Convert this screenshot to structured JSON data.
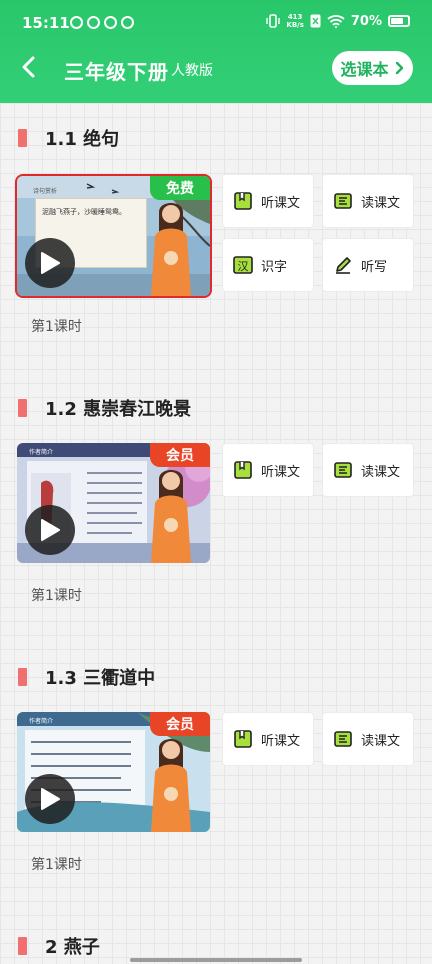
{
  "status_bar": {
    "time": "15:11",
    "net_speed": "413\nKB/s",
    "battery": "70%"
  },
  "header": {
    "title": "三年级下册",
    "edition": "人教版",
    "choose_label": "选课本"
  },
  "lessons": [
    {
      "title": "1.1 绝句",
      "badge": "免费",
      "period": "第1课时",
      "board_tag": "诗句赏析",
      "board_text": "泥融飞燕子，沙暖睡鸳鸯。",
      "tools": [
        "听课文",
        "读课文",
        "识字",
        "听写"
      ]
    },
    {
      "title": "1.2 惠崇春江晚景",
      "badge": "会员",
      "period": "第1课时",
      "board_tag": "作者简介",
      "board_text": "",
      "tools": [
        "听课文",
        "读课文"
      ]
    },
    {
      "title": "1.3 三衢道中",
      "badge": "会员",
      "period": "第1课时",
      "board_tag": "作者简介",
      "board_text": "",
      "tools": [
        "听课文",
        "读课文"
      ]
    },
    {
      "title": "2 燕子"
    }
  ],
  "colors": {
    "accent": "#29c76a",
    "section_bar": "#f07070",
    "free_badge": "#28c04b",
    "vip_badge": "#e84526",
    "selected_outline": "#e02a2a"
  }
}
